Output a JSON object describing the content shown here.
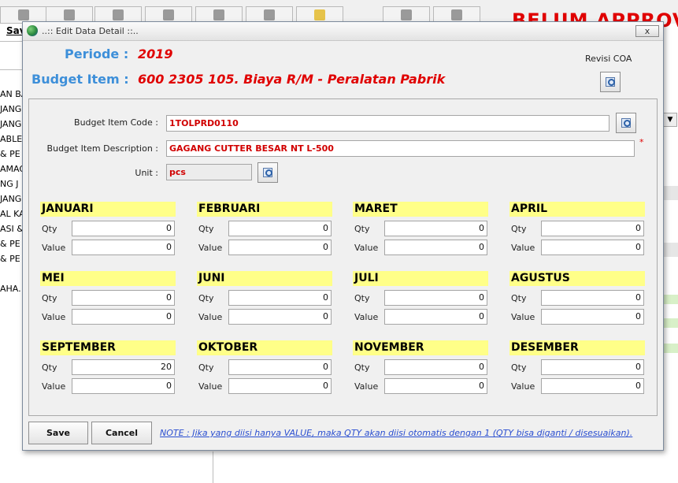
{
  "background": {
    "save_label": "Sav",
    "title_fragment": "BELUM APPROV",
    "list_items": [
      "AN BA",
      "JANG",
      "JANG",
      "ABLE",
      "& PE",
      "AMAG",
      "NG J",
      "JANG",
      "AL KA",
      "ASI &",
      "& PE",
      "& PE",
      "",
      "AHA."
    ]
  },
  "dialog": {
    "window_title": "..:: Edit Data Detail ::..",
    "close_label": "x",
    "periode_label": "Periode :",
    "periode_value": "2019",
    "budget_item_label": "Budget Item :",
    "budget_item_value": "600 2305 105.  Biaya R/M - Peralatan Pabrik",
    "revisi_coa_label": "Revisi COA",
    "form": {
      "code_label": "Budget Item Code :",
      "code_value": "1TOLPRD0110",
      "desc_label": "Budget Item Description :",
      "desc_value": "GAGANG CUTTER BESAR NT L-500",
      "required_mark": "*",
      "unit_label": "Unit :",
      "unit_value": "pcs"
    },
    "qty_label": "Qty",
    "value_label": "Value",
    "months": [
      {
        "name": "JANUARI",
        "qty": "0",
        "value": "0"
      },
      {
        "name": "FEBRUARI",
        "qty": "0",
        "value": "0"
      },
      {
        "name": "MARET",
        "qty": "0",
        "value": "0"
      },
      {
        "name": "APRIL",
        "qty": "0",
        "value": "0"
      },
      {
        "name": "MEI",
        "qty": "0",
        "value": "0"
      },
      {
        "name": "JUNI",
        "qty": "0",
        "value": "0"
      },
      {
        "name": "JULI",
        "qty": "0",
        "value": "0"
      },
      {
        "name": "AGUSTUS",
        "qty": "0",
        "value": "0"
      },
      {
        "name": "SEPTEMBER",
        "qty": "20",
        "value": "0"
      },
      {
        "name": "OKTOBER",
        "qty": "0",
        "value": "0"
      },
      {
        "name": "NOVEMBER",
        "qty": "0",
        "value": "0"
      },
      {
        "name": "DESEMBER",
        "qty": "0",
        "value": "0"
      }
    ],
    "save_button": "Save",
    "cancel_button": "Cancel",
    "note": "NOTE : Jika yang diisi hanya VALUE, maka QTY akan diisi otomatis dengan 1 (QTY bisa diganti / disesuaikan)."
  },
  "colors": {
    "accent_blue": "#3d8fd9",
    "value_red": "#e00000",
    "month_header": "#ffff88",
    "note_blue": "#2a4ed0"
  }
}
